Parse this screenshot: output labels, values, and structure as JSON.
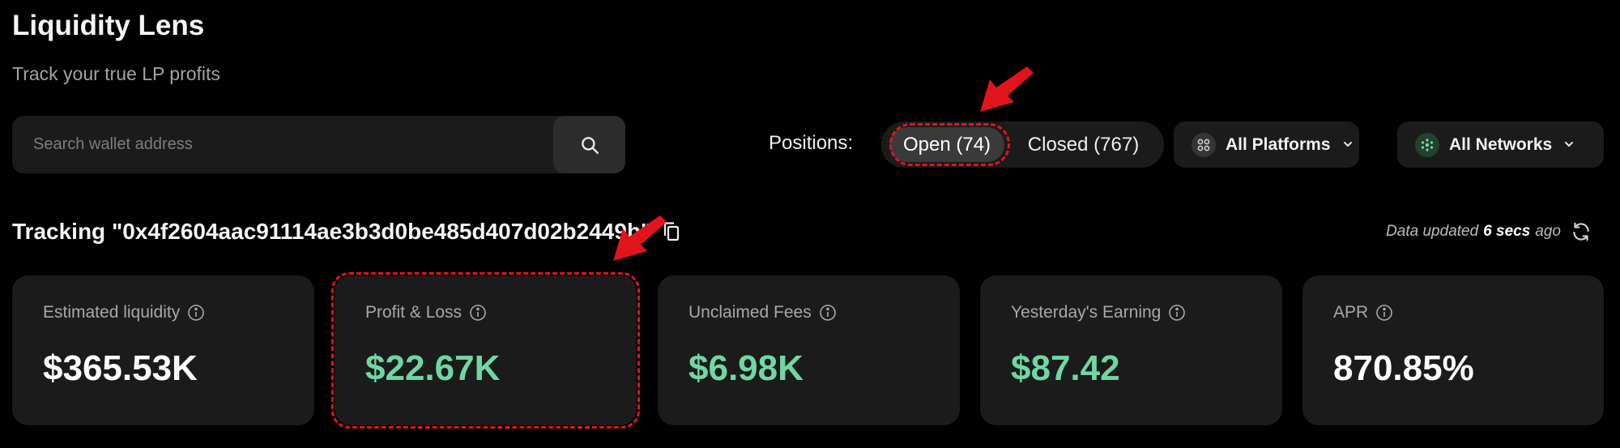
{
  "header": {
    "title": "Liquidity Lens",
    "subtitle": "Track your true LP profits"
  },
  "search": {
    "placeholder": "Search wallet address",
    "value": ""
  },
  "positions": {
    "label": "Positions:",
    "open_label": "Open (74)",
    "closed_label": "Closed (767)",
    "selected": "open"
  },
  "filters": {
    "platforms_label": "All Platforms",
    "networks_label": "All Networks"
  },
  "tracking": {
    "text": "Tracking \"0x4f2604aac91114ae3b3d0be485d407d02b2449b\""
  },
  "status": {
    "prefix": "Data updated",
    "time": "6 secs",
    "suffix": "ago"
  },
  "cards": [
    {
      "label": "Estimated liquidity",
      "value": "$365.53K"
    },
    {
      "label": "Profit & Loss",
      "value": "$22.67K"
    },
    {
      "label": "Unclaimed Fees",
      "value": "$6.98K"
    },
    {
      "label": "Yesterday's Earning",
      "value": "$87.42"
    },
    {
      "label": "APR",
      "value": "870.85%"
    }
  ],
  "colors": {
    "background": "#000000",
    "surface": "#1b1b1b",
    "positive": "#6fd7a3",
    "annotation": "#e0141c"
  },
  "icons": {
    "search": "search-icon",
    "platforms": "grid-icon",
    "networks": "network-icon",
    "chevron": "chevron-down-icon",
    "copy": "copy-icon",
    "refresh": "refresh-icon",
    "info": "info-icon"
  }
}
